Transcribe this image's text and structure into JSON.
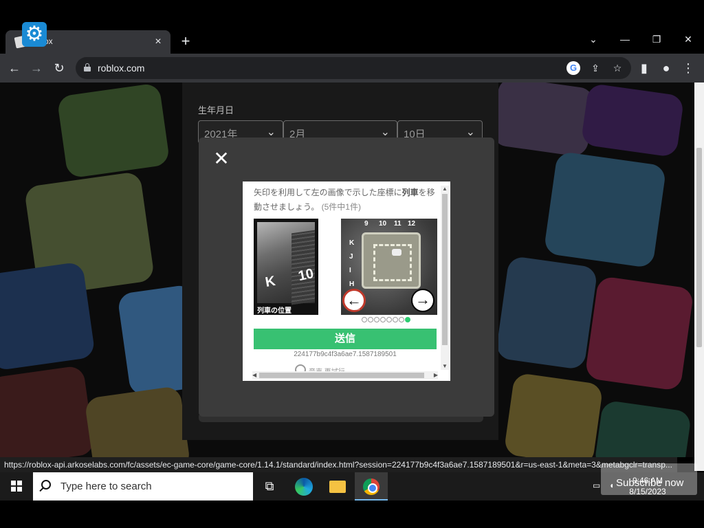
{
  "browser": {
    "tab_title": "ox",
    "tab_close": "×",
    "new_tab": "+",
    "url": "roblox.com",
    "window_controls": {
      "dropdown": "⌄",
      "minimize": "—",
      "restore": "❐",
      "close": "✕"
    },
    "status_url": "https://roblox-api.arkoselabs.com/fc/assets/ec-game-core/game-core/1.14.1/standard/index.html?session=224177b9c4f3a6ae7.1587189501&r=us-east-1&meta=3&metabgclr=transp..."
  },
  "signup": {
    "dob_label": "生年月日",
    "year": "2021年",
    "month": "2月",
    "day": "10日"
  },
  "captcha": {
    "instruction_pre": "矢印を利用して左の画像で示した座標に",
    "instruction_bold": "列車",
    "instruction_post": "を移動させましょう。",
    "counter": "(5件中1件)",
    "ref_letter": "K",
    "ref_number": "10",
    "ref_caption": "列車の位置",
    "col_labels": [
      "9",
      "10",
      "11",
      "12"
    ],
    "row_labels": [
      "K",
      "J",
      "I",
      "H"
    ],
    "left_arrow": "←",
    "right_arrow": "→",
    "dots_total": 8,
    "dots_active": 8,
    "submit_label": "送信",
    "session_id": "224177b9c4f3a6ae7.1587189501",
    "footer_text": "音声   再試行"
  },
  "taskbar": {
    "search_placeholder": "Type here to search",
    "time": "9:46 AM",
    "date": "8/15/2023"
  },
  "overlay": {
    "subscribe": "Subscribe now"
  },
  "colors": {
    "accent_green": "#38c172",
    "modal_bg": "#3b3b3b",
    "chrome_bg": "#35363a"
  }
}
